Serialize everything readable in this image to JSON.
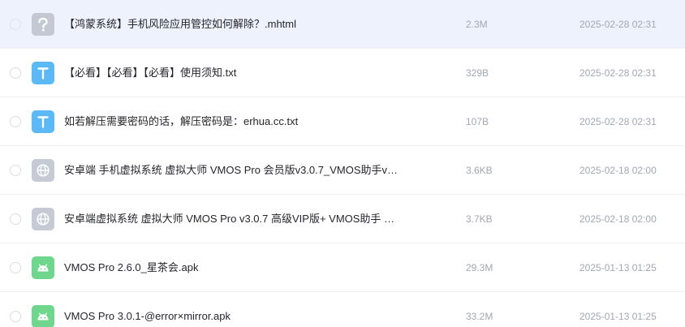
{
  "colors": {
    "selected_row_bg": "#eef2fd",
    "unknown_icon": "#c4c8d2",
    "text_icon": "#5bb9f6",
    "web_icon": "#c5cad4",
    "android_icon": "#6ed68d",
    "meta_text": "#a3a7b2"
  },
  "files": [
    {
      "name": "【鸿蒙系统】手机风险应用管控如何解除？.mhtml",
      "size": "2.3M",
      "date": "2025-02-28 02:31",
      "icon": "unknown-file-icon",
      "selected": true
    },
    {
      "name": "【必看】【必看】【必看】使用须知.txt",
      "size": "329B",
      "date": "2025-02-28 02:31",
      "icon": "text-file-icon",
      "selected": false
    },
    {
      "name": "如若解压需要密码的话，解压密码是：erhua.cc.txt",
      "size": "107B",
      "date": "2025-02-28 02:31",
      "icon": "text-file-icon",
      "selected": false
    },
    {
      "name": "安卓端 手机虚拟系统 虚拟大师 VMOS Pro 会员版v3.0.7_VMOS助手v…",
      "size": "3.6KB",
      "date": "2025-02-18 02:00",
      "icon": "web-link-icon",
      "selected": false
    },
    {
      "name": "安卓端虚拟系统 虚拟大师 VMOS Pro v3.0.7 高级VIP版+ VMOS助手 …",
      "size": "3.7KB",
      "date": "2025-02-18 02:00",
      "icon": "web-link-icon",
      "selected": false
    },
    {
      "name": "VMOS Pro 2.6.0_星茶会.apk",
      "size": "29.3M",
      "date": "2025-01-13 01:25",
      "icon": "android-apk-icon",
      "selected": false
    },
    {
      "name": "VMOS Pro 3.0.1-@error×mirror.apk",
      "size": "33.2M",
      "date": "2025-01-13 01:25",
      "icon": "android-apk-icon",
      "selected": false
    }
  ]
}
